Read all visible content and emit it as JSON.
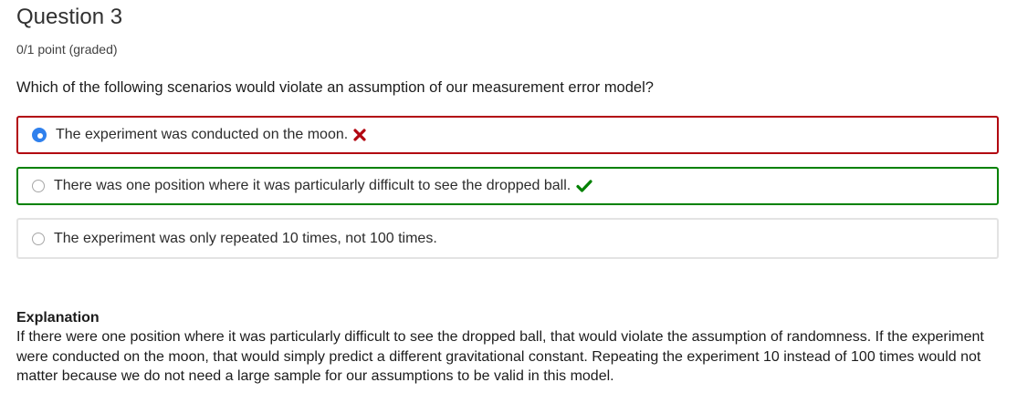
{
  "question": {
    "title": "Question 3",
    "points": "0/1 point (graded)",
    "prompt": "Which of the following scenarios would violate an assumption of our measurement error model?"
  },
  "options": [
    {
      "label": "The experiment was conducted on the moon.",
      "selected": true,
      "status": "incorrect",
      "icon": "cross-icon"
    },
    {
      "label": "There was one position where it was particularly difficult to see the dropped ball.",
      "selected": false,
      "status": "correct",
      "icon": "checkmark-icon"
    },
    {
      "label": "The experiment was only repeated 10 times, not 100 times.",
      "selected": false,
      "status": "neutral",
      "icon": ""
    }
  ],
  "explanation": {
    "heading": "Explanation",
    "text": "If there were one position where it was particularly difficult to see the dropped ball, that would violate the assumption of randomness. If the experiment were conducted on the moon, that would simply predict a different gravitational constant. Repeating the experiment 10 instead of 100 times would not matter because we do not need a large sample for our assumptions to be valid in this model."
  },
  "colors": {
    "incorrect": "#b20610",
    "correct": "#008100",
    "selected_radio": "#2f80ed"
  }
}
